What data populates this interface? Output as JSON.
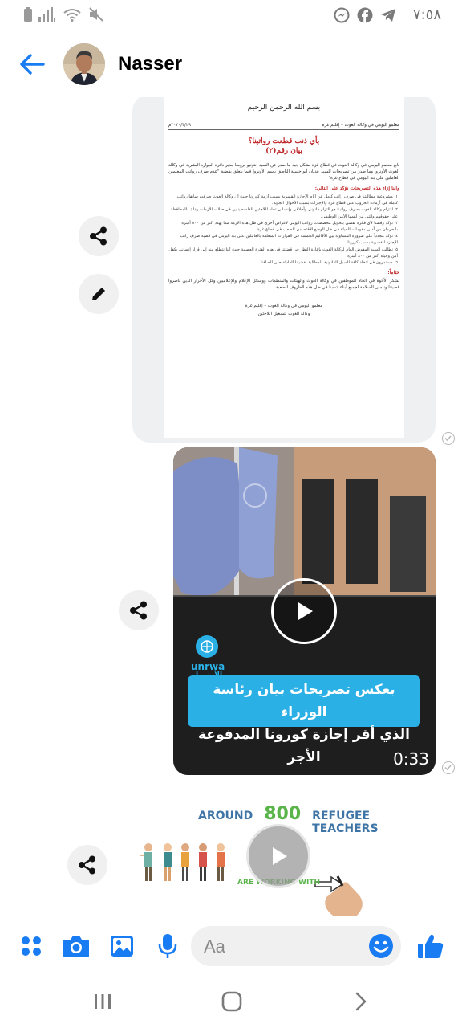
{
  "status_bar": {
    "time": "٧:٥٨",
    "left_icons": [
      "battery-icon",
      "signal-icon",
      "wifi-icon",
      "mute-icon"
    ],
    "right_icons": [
      "messenger-icon",
      "facebook-icon",
      "telegram-icon"
    ]
  },
  "header": {
    "contact_name": "Nasser",
    "back_icon": "arrow-back-icon",
    "accent_color": "#1a7cf2"
  },
  "document": {
    "basmala": "بسم الله الرحمن الرحيم",
    "header_right": "معلمو اليومي في وكالة الغوث – إقليم غزة",
    "header_left": "٢٠٢٠/٣/٢٩م",
    "title_line1": "بأي ذنب قطعت رواتبنا؟",
    "title_line2": "بيان رقم(٢)",
    "intro": "تابع معلمو اليومي في وكالة الغوث في قطاع غزة بشكل جيد ما صدر عن السيد أنتونيو بروسا مدير دائرة الموارد البشرية في وكالة الغوث الأونروا وما صدر من تصريحات للسيد عدنان أبو حسنة الناطق باسم الأونروا فيما يتعلق بقضية \"عدم صرف رواتب المعلمين العاملين على بند اليومي في قطاع غزة\"",
    "points_heading": "واننا إزاء هذه التصريحات نؤكد على التالي:",
    "points": [
      "١. مشروعية مطالبتنا في صرف راتب كامل عن أيام الإجازة القسرية بسبب أزمة كورونا حيث أن وكالة الغوث صرفت سابقاً رواتب كاملة في أزمات الحروب على قطاع غزة والإجازات بسبب الأحوال الجوية.",
      "٢. التزام وكالة الغوث بصرف رواتبنا هو التزام قانوني وأخلاقي وإنساني تجاه اللاجئين الفلسطينيين في حالات الأزمات وذلك بالمحافظة على حقوقهم والتي من أهمها الأمن الوظيفي.",
      "٣. نؤكد رفضنا لأي فكرة تقضي بتحويل مخصصات رواتب اليومي لأغراض أخرى في ظل هذه الأزمة مما يهدد أكثر من ٨٠٠ أسرة بالحرمان من أدنى مقومات الحياة في ظل الوضع الاقتصادي الصعب في قطاع غزة.",
      "٤. نؤكد مجدداً على ضرورة المساواة بين الأقاليم الخمسة في القرارات المتعلقة بالعاملين على بند اليومي في قضية صرف راتب الإجازة القسرية بسبب كورونا.",
      "٥. نطالب السيد المفوض العام لوكالة الغوث بإعادة النظر في قضيتنا في هذه الفترة العصيبة حيث أننا نتطلع منه إلى قرار إنساني يكفل أمن وحياة أكثر من ٨٠٠ أسرة.",
      "٦. مستمرون في اتخاذ كافة السبل القانونية للمطالبة بقضيتنا العادلة حتى الصافنا."
    ],
    "closing_heading": "ختاماً:",
    "closing": "نشكر الأخوة في اتحاد الموظفين في وكالة الغوث والهيئات والمنظمات ووسائل الإعلام والإعلاميين وكل الأحرار الذين ناصروا قضيتنا ونتمنى السلامة لجميع أبناء شعبنا في ظل هذه الظروف الصعبة.",
    "sign1": "معلمو اليومي في وكالة الغوث – إقليم غزة",
    "sign2": "وكالة الغوث لتشغيل اللاجئين"
  },
  "video1": {
    "logo_text": "unrwa",
    "logo_text_ar": "الأونروا",
    "caption_line1": "بعكس تصريحات بيان رئاسة الوزراء",
    "caption_line2": "الذي أقر إجازة كورونا المدفوعة الأجر",
    "duration": "0:33"
  },
  "video2": {
    "around": "AROUND",
    "number": "800",
    "teachers": "REFUGEE TEACHERS",
    "working": "ARE WORKING WITH"
  },
  "composer": {
    "placeholder": "Aa",
    "icons": [
      "apps-icon",
      "camera-icon",
      "gallery-icon",
      "microphone-icon",
      "emoji-icon",
      "thumbs-up-icon"
    ]
  },
  "nav": {
    "icons": [
      "recents-icon",
      "home-icon",
      "back-icon"
    ]
  }
}
